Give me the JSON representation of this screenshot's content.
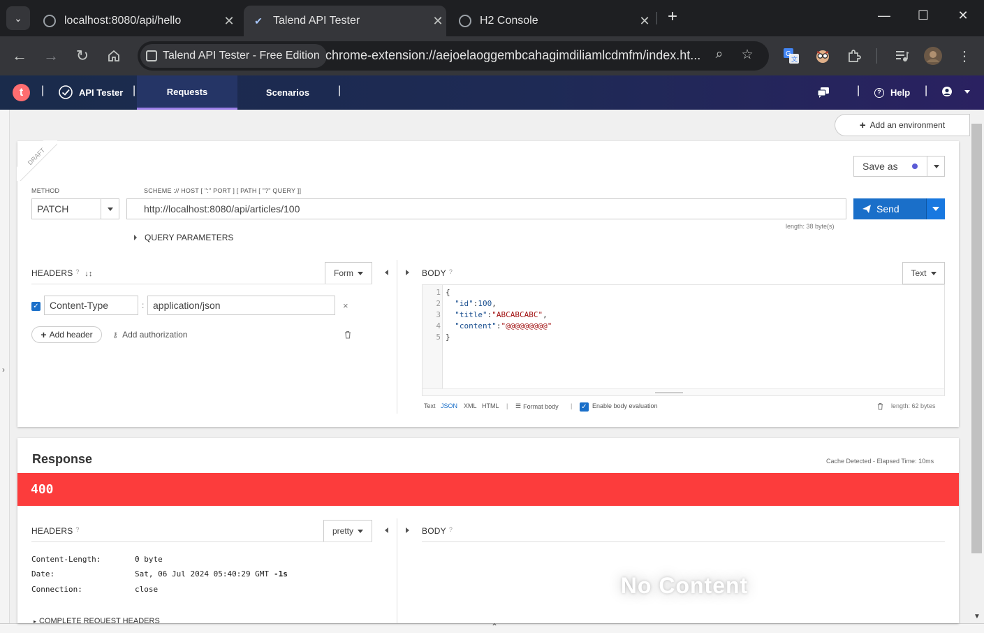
{
  "browser": {
    "tabs": [
      {
        "title": "localhost:8080/api/hello",
        "active": false
      },
      {
        "title": "Talend API Tester",
        "active": true
      },
      {
        "title": "H2 Console",
        "active": false
      }
    ],
    "chip_label": "Talend API Tester - Free Edition",
    "url": "chrome-extension://aejoelaoggembcahagimdiliamlcdmfm/index.ht...",
    "icons": {
      "tab_search": "chevron-down-icon",
      "new_tab": "plus-icon",
      "minimize": "minimize-icon",
      "maximize": "maximize-icon",
      "close": "close-icon",
      "back": "back-arrow-icon",
      "forward": "forward-arrow-icon",
      "reload": "reload-icon",
      "home": "home-icon",
      "zoom": "zoom-icon",
      "bookmark": "star-icon",
      "translate": "translate-icon",
      "extensions": "puzzle-icon",
      "media": "media-control-icon",
      "profile": "profile-avatar-icon",
      "menu": "kebab-menu-icon"
    }
  },
  "nav": {
    "logo": "t",
    "product": "API Tester",
    "tabs": [
      "Requests",
      "Scenarios"
    ],
    "active_tab": "Requests",
    "help": "Help"
  },
  "env": {
    "add_label": "Add an environment"
  },
  "request": {
    "draft_label": "DRAFT",
    "method_label": "METHOD",
    "method": "PATCH",
    "url_label": "SCHEME :// HOST [ \":\" PORT ] [ PATH [ \"?\" QUERY ]]",
    "url": "http://localhost:8080/api/articles/100",
    "url_length": "length: 38 byte(s)",
    "save_as": "Save as",
    "send": "Send",
    "query_params": "QUERY PARAMETERS",
    "headers_title": "HEADERS",
    "headers_mode": "Form",
    "headers": [
      {
        "enabled": true,
        "name": "Content-Type",
        "value": "application/json"
      }
    ],
    "add_header": "Add header",
    "add_authorization": "Add authorization",
    "body_title": "BODY",
    "body_mode": "Text",
    "body_lines": [
      "1",
      "2",
      "3",
      "4",
      "5"
    ],
    "body_code": {
      "l1": "{",
      "l2_key": "\"id\"",
      "l2_val": "100",
      "l3_key": "\"title\"",
      "l3_val": "\"ABCABCABC\"",
      "l4_key": "\"content\"",
      "l4_val": "\"@@@@@@@@@\"",
      "l5": "}"
    },
    "body_formats": [
      "Text",
      "JSON",
      "XML",
      "HTML"
    ],
    "active_format": "JSON",
    "format_body": "Format body",
    "enable_eval": "Enable body evaluation",
    "body_length": "length: 62 bytes"
  },
  "response": {
    "title": "Response",
    "meta": "Cache Detected - Elapsed Time: 10ms",
    "status": "400",
    "status_color": "#fc3c3c",
    "headers_title": "HEADERS",
    "headers_mode": "pretty",
    "headers": [
      {
        "name": "Content-Length:",
        "value": "0 byte"
      },
      {
        "name": "Date:",
        "value": "Sat, 06 Jul 2024 05:40:29 GMT",
        "extra": "-1s"
      },
      {
        "name": "Connection:",
        "value": "close"
      }
    ],
    "complete_headers": "COMPLETE REQUEST HEADERS",
    "body_title": "BODY",
    "no_content": "No Content"
  }
}
